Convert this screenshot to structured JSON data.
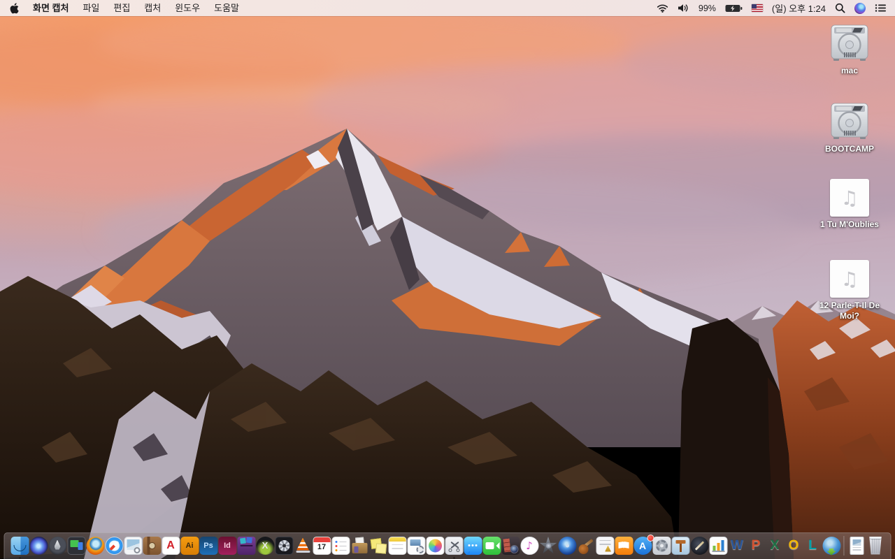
{
  "menu_bar": {
    "menus": [
      "화면 캡처",
      "파일",
      "편집",
      "캡처",
      "윈도우",
      "도움말"
    ],
    "battery_percent": "99%",
    "clock": "(일) 오후 1:24",
    "status_icons": [
      "wifi-icon",
      "volume-icon",
      "battery-charging-icon",
      "keyboard-flag-us-icon",
      "spotlight-search-icon",
      "siri-icon",
      "notification-center-icon"
    ]
  },
  "desktop": {
    "icons": [
      {
        "label": "mac",
        "kind": "hard-drive"
      },
      {
        "label": "BOOTCAMP",
        "kind": "hard-drive"
      },
      {
        "label": "1 Tu M'Oublies",
        "kind": "audio-file"
      },
      {
        "label": "12 Parle-T-Il De Moi?",
        "kind": "audio-file"
      }
    ]
  },
  "dock": {
    "items": [
      {
        "name": "finder",
        "running": true
      },
      {
        "name": "siri"
      },
      {
        "name": "launchpad"
      },
      {
        "name": "displays"
      },
      {
        "name": "firefox"
      },
      {
        "name": "safari"
      },
      {
        "name": "preview"
      },
      {
        "name": "journal"
      },
      {
        "name": "acrobat-reader",
        "glyph": "A"
      },
      {
        "name": "illustrator",
        "glyph": "Ai"
      },
      {
        "name": "photoshop",
        "glyph": "Ps"
      },
      {
        "name": "indesign",
        "glyph": "Id"
      },
      {
        "name": "toast"
      },
      {
        "name": "x-viewer",
        "glyph": "X"
      },
      {
        "name": "disk-fan-utility"
      },
      {
        "name": "vlc"
      },
      {
        "name": "calendar",
        "glyph": "17"
      },
      {
        "name": "reminders"
      },
      {
        "name": "archive-box"
      },
      {
        "name": "stickies"
      },
      {
        "name": "notes"
      },
      {
        "name": "script-doc"
      },
      {
        "name": "photos"
      },
      {
        "name": "grab",
        "running": true
      },
      {
        "name": "messages"
      },
      {
        "name": "facetime"
      },
      {
        "name": "photo-booth"
      },
      {
        "name": "itunes",
        "glyph": "♪"
      },
      {
        "name": "imovie"
      },
      {
        "name": "idvd"
      },
      {
        "name": "garageband"
      },
      {
        "name": "media-docs"
      },
      {
        "name": "ibooks"
      },
      {
        "name": "app-store",
        "glyph": "A",
        "badge": true
      },
      {
        "name": "system-preferences"
      },
      {
        "name": "keynote"
      },
      {
        "name": "pages"
      },
      {
        "name": "numbers"
      },
      {
        "name": "word",
        "glyph": "W",
        "color": "#2a5699"
      },
      {
        "name": "powerpoint",
        "glyph": "P",
        "color": "#d35230"
      },
      {
        "name": "excel",
        "glyph": "X",
        "color": "#1e7145"
      },
      {
        "name": "outlook",
        "glyph": "O",
        "color": "#f2b705"
      },
      {
        "name": "lync",
        "glyph": "L",
        "color": "#00a0a8"
      },
      {
        "name": "globe-download"
      },
      {
        "name": "separator",
        "separator": true
      },
      {
        "name": "document-file"
      },
      {
        "name": "trash"
      }
    ]
  },
  "colors": {
    "menubar_bg": "#f2e4e2",
    "sky_orange": "#ee9468",
    "sky_lavender": "#c3a6b6",
    "rock_orange": "#d0693a",
    "foreground_rock": "#241a12"
  }
}
